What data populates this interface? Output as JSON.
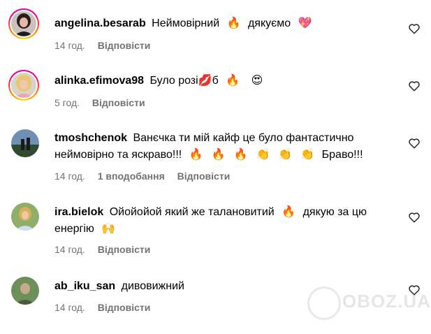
{
  "comments": [
    {
      "username": "angelina.besarab",
      "text": "Неймовірний",
      "emojis_mid": [
        "🔥"
      ],
      "text2": "дякуємо",
      "emojis_end": [
        "💖"
      ],
      "time": "14 год.",
      "reply": "Відповісти",
      "has_story_ring": true
    },
    {
      "username": "alinka.efimova98",
      "text": "Було розі",
      "emojis_mid": [
        "💋"
      ],
      "text2": "б",
      "emojis_end": [
        "🔥",
        "😍"
      ],
      "time": "5 год.",
      "reply": "Відповісти",
      "has_story_ring": true
    },
    {
      "username": "tmoshchenok",
      "text": "Ванєчка ти мій кайф це було фантастично неймовірно та яскраво!!!",
      "emojis_end": [
        "🔥",
        "🔥",
        "🔥",
        "👏",
        "👏",
        "👏"
      ],
      "text2": "Браво!!!",
      "time": "14 год.",
      "likes": "1 вподобання",
      "reply": "Відповісти",
      "has_story_ring": false
    },
    {
      "username": "ira.bielok",
      "text": "Ойойойой який же талановитий",
      "emojis_mid": [
        "🔥"
      ],
      "text2": "дякую за цю енергію",
      "emojis_end": [
        "🙌"
      ],
      "time": "14 год.",
      "reply": "Відповісти",
      "has_story_ring": false
    },
    {
      "username": "ab_iku_san",
      "text": "дивовижний",
      "time": "14 год.",
      "reply": "Відповісти",
      "has_story_ring": false
    }
  ],
  "watermark": "OBOZ.UA",
  "icons": {
    "like": "heart-outline-icon"
  }
}
